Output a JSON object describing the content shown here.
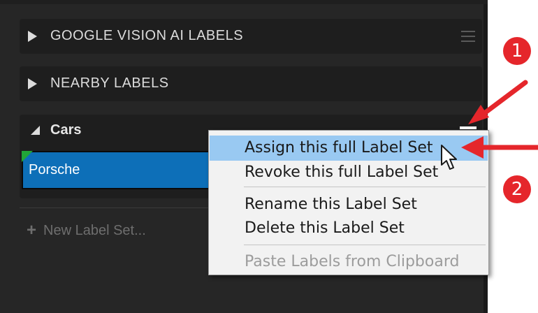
{
  "sections": [
    {
      "title": "GOOGLE VISION AI LABELS"
    },
    {
      "title": "NEARBY LABELS"
    }
  ],
  "label_set": {
    "title": "Cars",
    "labels": [
      "Porsche"
    ]
  },
  "new_label_set": "New Label Set...",
  "context_menu": {
    "items": [
      "Assign this full Label Set",
      "Revoke this full Label Set",
      "Rename this Label Set",
      "Delete this Label Set",
      "Paste Labels from Clipboard"
    ],
    "highlighted": "Assign this full Label Set",
    "disabled": "Paste Labels from Clipboard"
  },
  "callouts": [
    "1",
    "2"
  ],
  "colors": {
    "panel": "#262626",
    "chip": "#0d6fb8",
    "menu_highlight": "#99c9f2",
    "callout": "#e5262b"
  }
}
